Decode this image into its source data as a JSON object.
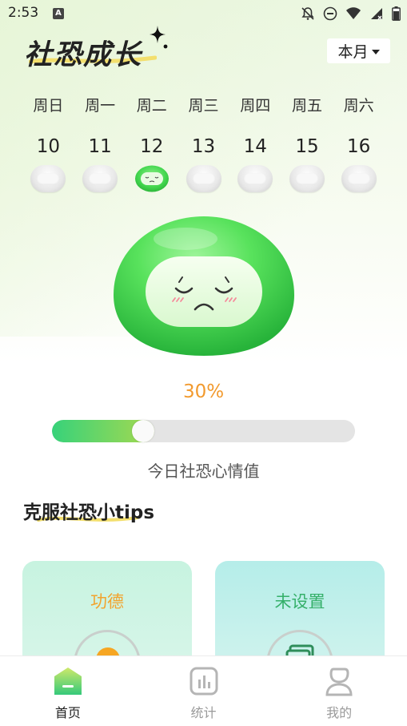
{
  "status_bar": {
    "time": "2:53",
    "icons": [
      "notification-a-icon",
      "mute-icon",
      "do-not-disturb-icon",
      "wifi-icon",
      "signal-icon",
      "battery-icon"
    ]
  },
  "header": {
    "title": "社恐成长",
    "month_selector": {
      "selected": "本月"
    }
  },
  "week": {
    "days": [
      {
        "weekday": "周日",
        "date": "10",
        "mood": "empty"
      },
      {
        "weekday": "周一",
        "date": "11",
        "mood": "empty"
      },
      {
        "weekday": "周二",
        "date": "12",
        "mood": "sad-green",
        "selected": true
      },
      {
        "weekday": "周三",
        "date": "13",
        "mood": "empty"
      },
      {
        "weekday": "周四",
        "date": "14",
        "mood": "empty"
      },
      {
        "weekday": "周五",
        "date": "15",
        "mood": "empty"
      },
      {
        "weekday": "周六",
        "date": "16",
        "mood": "empty"
      }
    ]
  },
  "mood_today": {
    "percent_text": "30%",
    "progress_fraction": 0.3,
    "caption": "今日社恐心情值"
  },
  "tips": {
    "section_title": "克服社恐小tips",
    "cards": [
      {
        "label": "功德"
      },
      {
        "label": "未设置"
      }
    ]
  },
  "bottom_nav": {
    "items": [
      {
        "label": "首页",
        "icon": "home-icon",
        "active": true
      },
      {
        "label": "统计",
        "icon": "statistics-icon",
        "active": false
      },
      {
        "label": "我的",
        "icon": "profile-icon",
        "active": false
      }
    ]
  },
  "colors": {
    "accent_green": "#37d27a",
    "percent_orange": "#f29a2e",
    "tip_gold": "#f2a32e",
    "tip_green": "#35b06a"
  }
}
